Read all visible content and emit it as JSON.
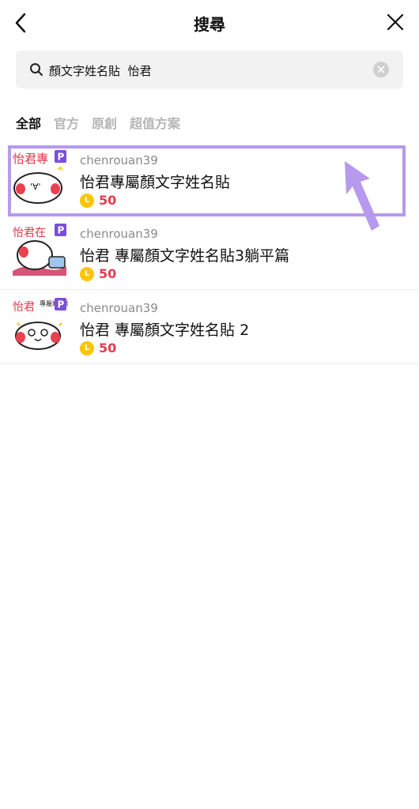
{
  "header": {
    "title": "搜尋"
  },
  "search": {
    "value": "顏文字姓名貼  怡君"
  },
  "tabs": [
    "全部",
    "官方",
    "原創",
    "超值方案"
  ],
  "items": [
    {
      "author": "chenrouan39",
      "name": "怡君專屬顏文字姓名貼",
      "price": "50",
      "thumb_text": "怡君專",
      "badge": "P"
    },
    {
      "author": "chenrouan39",
      "name": "怡君 專屬顏文字姓名貼3躺平篇",
      "price": "50",
      "thumb_text": "怡君在",
      "badge": "P"
    },
    {
      "author": "chenrouan39",
      "name": "怡君 專屬顏文字姓名貼 2",
      "price": "50",
      "thumb_text": "怡君",
      "thumb_text2": "專屬姓名貼",
      "badge": "P"
    }
  ],
  "coin_symbol": "L",
  "colors": {
    "accent_highlight": "#b799ee",
    "price": "#e83a4f",
    "coin": "#ffc400",
    "premium_badge": "#7a4fdc"
  }
}
